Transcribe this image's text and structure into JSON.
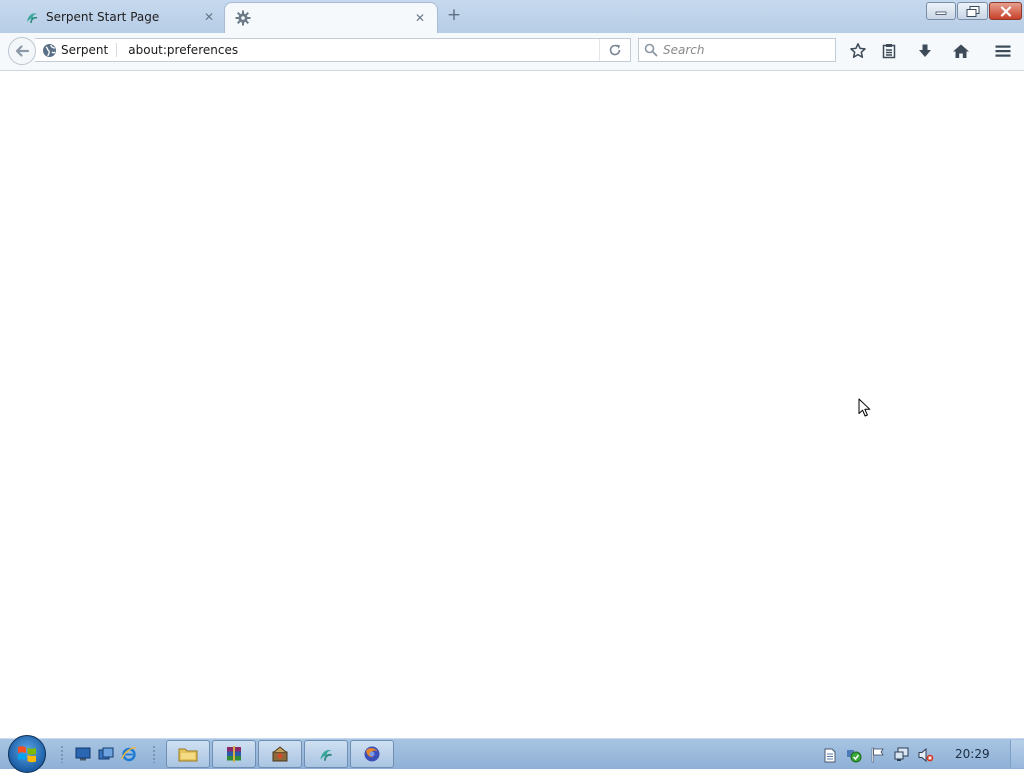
{
  "browser": {
    "tabs": [
      {
        "label": "Serpent Start Page",
        "icon": "serpent-logo-icon",
        "active": false
      },
      {
        "label": "",
        "icon": "gear-icon",
        "active": true
      }
    ],
    "new_tab_icon": "plus-icon",
    "window_controls": [
      "minimize-icon",
      "restore-icon",
      "close-icon"
    ]
  },
  "navbar": {
    "identity_label": "Serpent",
    "url": "about:preferences",
    "search_placeholder": "Search",
    "buttons": [
      "back-arrow-icon",
      "reload-icon",
      "search-icon",
      "bookmark-star-icon",
      "bookmarks-list-icon",
      "download-arrow-icon",
      "home-icon",
      "hamburger-menu-icon"
    ]
  },
  "content": {},
  "taskbar": {
    "clock": "20:29",
    "quick_launch": [
      "show-desktop-icon",
      "switch-windows-icon",
      "internet-explorer-icon"
    ],
    "tasks": [
      "file-explorer-icon",
      "winrar-icon",
      "installer-icon",
      "serpent-browser-icon",
      "firefox-icon"
    ],
    "tray": [
      "document-icon",
      "security-shield-icon",
      "action-center-flag-icon",
      "network-icon",
      "volume-muted-icon"
    ]
  },
  "colors": {
    "titlebar": "#c6d9ee",
    "toolbar": "#f6f9fc",
    "taskbar": "#9dbbdc",
    "close_button": "#c8412b",
    "serpent_teal": "#3aa79a"
  }
}
